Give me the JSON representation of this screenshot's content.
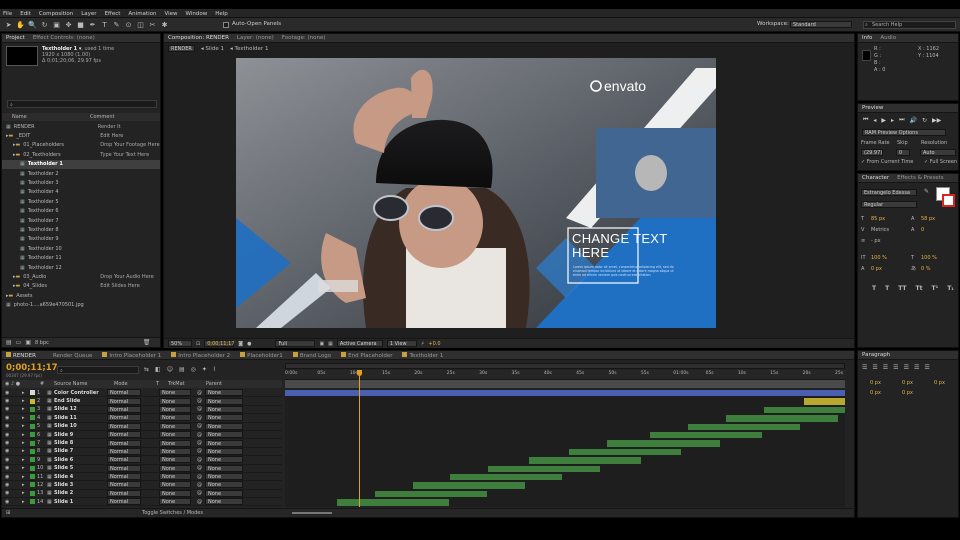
{
  "menu": {
    "items": [
      "File",
      "Edit",
      "Composition",
      "Layer",
      "Effect",
      "Animation",
      "View",
      "Window",
      "Help"
    ]
  },
  "toolbar": {
    "icons": [
      "select-tool-icon",
      "hand-tool-icon",
      "zoom-tool-icon",
      "rotate-tool-icon",
      "camera-tool-icon",
      "pan-tool-icon",
      "rect-tool-icon",
      "pen-tool-icon",
      "type-tool-icon",
      "brush-tool-icon",
      "stamp-tool-icon",
      "eraser-tool-icon",
      "roto-tool-icon",
      "puppet-tool-icon"
    ],
    "auto_open": "Auto-Open Panels",
    "workspace_label": "Workspace:",
    "workspace_value": "Standard",
    "search_help": "Search Help"
  },
  "project": {
    "tabs": [
      "Project",
      "Effect Controls: (none)"
    ],
    "item_name": "Textholder 1 ▾",
    "item_used": ", used 1 time",
    "item_size": "1920 x 1080 (1.00)",
    "item_duration": "Δ 0;01;20;06, 29.97 fps",
    "col_name": "Name",
    "col_comment": "Comment",
    "bpc": "8 bpc",
    "items": [
      {
        "name": "RENDER",
        "comment": "Render It",
        "indent": 0,
        "type": "comp"
      },
      {
        "name": "_EDIT",
        "comment": "Edit Here",
        "indent": 0,
        "type": "folder"
      },
      {
        "name": "01_Placeholders",
        "comment": "Drop Your Footage Here",
        "indent": 1,
        "type": "folder"
      },
      {
        "name": "02_Textholders",
        "comment": "Type Your Text Here",
        "indent": 1,
        "type": "folder"
      },
      {
        "name": "Textholder 1",
        "comment": "",
        "indent": 2,
        "type": "comp",
        "selected": true
      },
      {
        "name": "Textholder 2",
        "comment": "",
        "indent": 2,
        "type": "comp"
      },
      {
        "name": "Textholder 3",
        "comment": "",
        "indent": 2,
        "type": "comp"
      },
      {
        "name": "Textholder 4",
        "comment": "",
        "indent": 2,
        "type": "comp"
      },
      {
        "name": "Textholder 5",
        "comment": "",
        "indent": 2,
        "type": "comp"
      },
      {
        "name": "Textholder 6",
        "comment": "",
        "indent": 2,
        "type": "comp"
      },
      {
        "name": "Textholder 7",
        "comment": "",
        "indent": 2,
        "type": "comp"
      },
      {
        "name": "Textholder 8",
        "comment": "",
        "indent": 2,
        "type": "comp"
      },
      {
        "name": "Textholder 9",
        "comment": "",
        "indent": 2,
        "type": "comp"
      },
      {
        "name": "Textholder 10",
        "comment": "",
        "indent": 2,
        "type": "comp"
      },
      {
        "name": "Textholder 11",
        "comment": "",
        "indent": 2,
        "type": "comp"
      },
      {
        "name": "Textholder 12",
        "comment": "",
        "indent": 2,
        "type": "comp"
      },
      {
        "name": "03_Audio",
        "comment": "Drop Your Audio Here",
        "indent": 1,
        "type": "folder"
      },
      {
        "name": "04_Slides",
        "comment": "Edit Slides Here",
        "indent": 1,
        "type": "folder"
      },
      {
        "name": "Assets",
        "comment": "",
        "indent": 0,
        "type": "folder"
      },
      {
        "name": "photo-1....a659e470501.jpg",
        "comment": "",
        "indent": 0,
        "type": "file"
      }
    ]
  },
  "composition": {
    "tabs": [
      "Composition: RENDER",
      "Layer: (none)",
      "Footage: (none)"
    ],
    "crumbs": [
      "RENDER",
      "Slide 1",
      "Textholder 1"
    ],
    "zoom": "50%",
    "timecode": "0;00;11;17",
    "resolution": "Full",
    "camera": "Active Camera",
    "views": "1 View",
    "exposure": "+0.0",
    "brand": "envato",
    "headline": "CHANGE TEXT HERE",
    "body_lines": [
      "Lorem ipsum dolor sit amet, consectetur adipiscing elit, sed do",
      "eiusmod tempor incididunt ut labore et dolore magna aliqua ut",
      "enim ad minim veniam quis nostrud exercitation"
    ]
  },
  "info": {
    "tabs": [
      "Info",
      "Audio"
    ],
    "r": "R :",
    "g": "G :",
    "b": "B :",
    "a": "A : 0",
    "x": "X : 1162",
    "y": "Y : 1104"
  },
  "preview": {
    "title": "Preview",
    "options": "RAM Preview Options",
    "frame_rate_label": "Frame Rate",
    "skip_label": "Skip",
    "res_label": "Resolution",
    "frame_rate": "(29.97)",
    "skip": "0",
    "res": "Auto",
    "from_current": "From Current Time",
    "full_screen": "Full Screen"
  },
  "character": {
    "tabs": [
      "Character",
      "Effects & Presets"
    ],
    "font": "Estrangelo Edessa",
    "style": "Regular",
    "size": "85 px",
    "leading": "58 px",
    "tracking": "Metrics",
    "kerning": "0",
    "stroke": "- px",
    "vscale": "100 %",
    "hscale": "100 %",
    "baseline": "0 px",
    "tsume": "0 %",
    "styles": [
      "T",
      "T",
      "TT",
      "Tt",
      "T¹",
      "T₁"
    ]
  },
  "paragraph": {
    "title": "Paragraph",
    "vals": [
      "0 px",
      "0 px",
      "0 px",
      "0 px",
      "0 px"
    ]
  },
  "timeline": {
    "tabs": [
      "RENDER",
      "Render Queue",
      "Intro Placeholder 1",
      "Intro Placeholder 2",
      "Placeholder1",
      "Brand Logo",
      "End Placeholder",
      "Textholder 1"
    ],
    "timecode": "0;00;11;17",
    "timecode_sub": "00347 (29.97 fps)",
    "cols": [
      "#",
      "Source Name",
      "Mode",
      "T",
      "TrkMat",
      "Parent"
    ],
    "ruler": [
      "0:00s",
      "05s",
      "10s",
      "15s",
      "20s",
      "25s",
      "30s",
      "35s",
      "40s",
      "45s",
      "50s",
      "55s",
      "01:00s",
      "05s",
      "10s",
      "15s",
      "20s",
      "25s"
    ],
    "toggle": "Toggle Switches / Modes",
    "mode": "Normal",
    "trkmat": "None",
    "parent": "None",
    "layers": [
      {
        "n": "1",
        "name": "Color Controller",
        "color": "#d8d8d8",
        "bar": "#4a5fb0",
        "start": 0,
        "end": 1
      },
      {
        "n": "2",
        "name": "End Slide",
        "color": "#c8b830",
        "bar": "#b8a830",
        "start": 0.927,
        "end": 1
      },
      {
        "n": "3",
        "name": "Slide 12",
        "color": "#3c9a3c",
        "bar": "#3e7f3e",
        "start": 0.855,
        "end": 1
      },
      {
        "n": "4",
        "name": "Slide 11",
        "color": "#3c9a3c",
        "bar": "#3e7f3e",
        "start": 0.788,
        "end": 0.988
      },
      {
        "n": "5",
        "name": "Slide 10",
        "color": "#3c9a3c",
        "bar": "#3e7f3e",
        "start": 0.72,
        "end": 0.92
      },
      {
        "n": "6",
        "name": "Slide 9",
        "color": "#3c9a3c",
        "bar": "#3e7f3e",
        "start": 0.652,
        "end": 0.852
      },
      {
        "n": "7",
        "name": "Slide 8",
        "color": "#3c9a3c",
        "bar": "#3e7f3e",
        "start": 0.575,
        "end": 0.776
      },
      {
        "n": "8",
        "name": "Slide 7",
        "color": "#3c9a3c",
        "bar": "#3e7f3e",
        "start": 0.507,
        "end": 0.707
      },
      {
        "n": "9",
        "name": "Slide 6",
        "color": "#3c9a3c",
        "bar": "#3e7f3e",
        "start": 0.435,
        "end": 0.635
      },
      {
        "n": "10",
        "name": "Slide 5",
        "color": "#3c9a3c",
        "bar": "#3e7f3e",
        "start": 0.363,
        "end": 0.563
      },
      {
        "n": "11",
        "name": "Slide 4",
        "color": "#3c9a3c",
        "bar": "#3e7f3e",
        "start": 0.295,
        "end": 0.495
      },
      {
        "n": "12",
        "name": "Slide 3",
        "color": "#3c9a3c",
        "bar": "#3e7f3e",
        "start": 0.228,
        "end": 0.428
      },
      {
        "n": "13",
        "name": "Slide 2",
        "color": "#3c9a3c",
        "bar": "#3e7f3e",
        "start": 0.16,
        "end": 0.36
      },
      {
        "n": "14",
        "name": "Slide 1",
        "color": "#3c9a3c",
        "bar": "#3e7f3e",
        "start": 0.093,
        "end": 0.293
      }
    ],
    "playhead": 0.133
  },
  "colors": {
    "accent": "#2b7fd4",
    "blue_slide": "#1f6fc2",
    "timecode": "#e0a020"
  }
}
